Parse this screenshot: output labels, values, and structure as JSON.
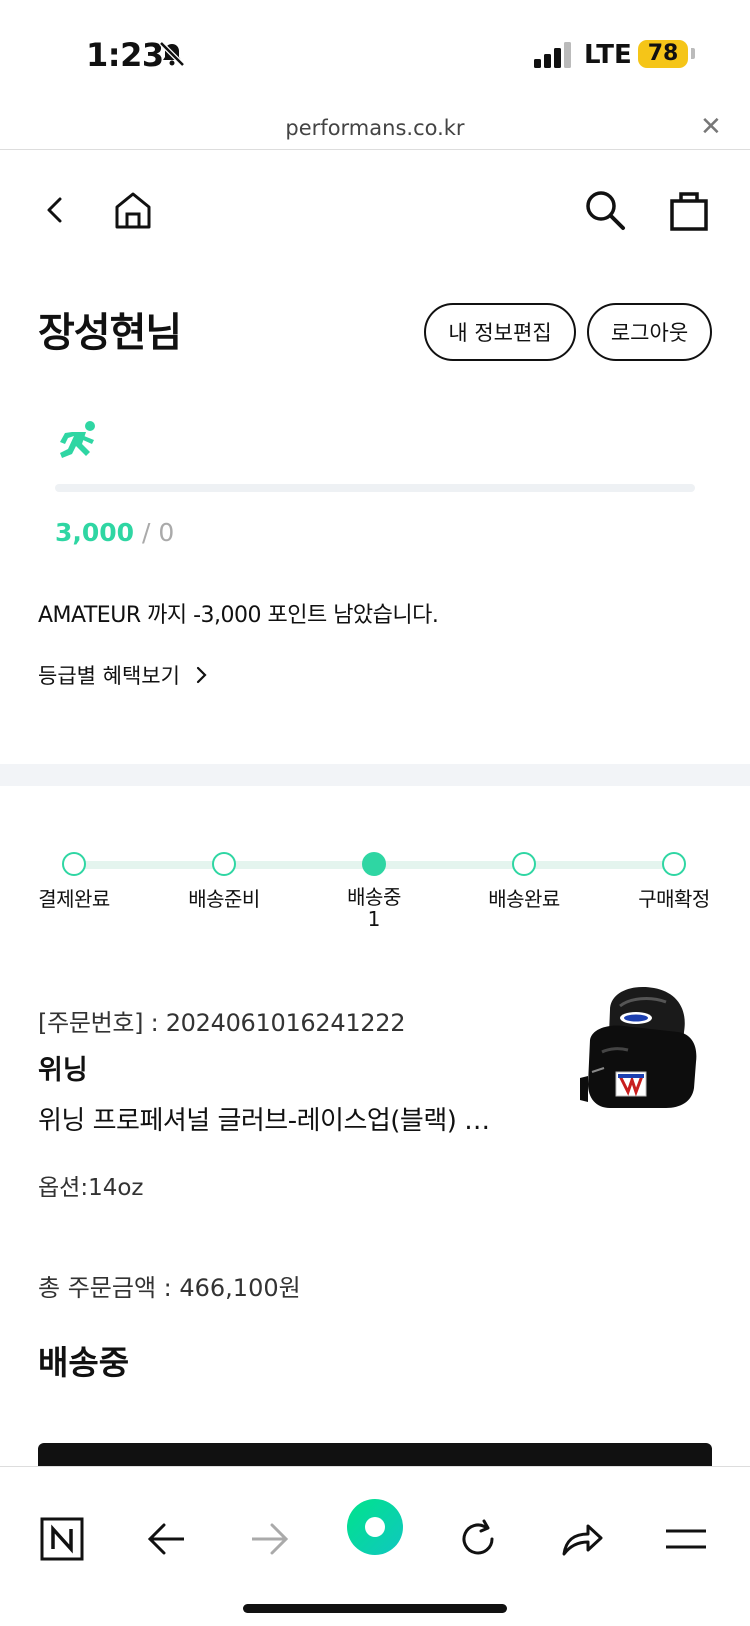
{
  "status_bar": {
    "time": "1:23",
    "network": "LTE",
    "battery": "78",
    "icons": [
      "bell-muted-icon",
      "signal-icon"
    ]
  },
  "browser": {
    "url": "performans.co.kr",
    "close_icon": "close-icon"
  },
  "header": {
    "icons": [
      "back-icon",
      "home-icon",
      "search-icon",
      "shopping-bag-icon"
    ]
  },
  "user": {
    "name": "장성현님",
    "edit_profile_label": "내 정보편집",
    "logout_label": "로그아웃",
    "points_current": "3,000",
    "points_sep": "/",
    "points_max": "0",
    "progress_fraction": 1.0,
    "grade_message": "AMATEUR 까지 -3,000 포인트 남았습니다.",
    "benefits_link": "등급별 혜택보기",
    "accent_color": "#2fd6a3"
  },
  "order_steps": [
    {
      "label": "결제완료",
      "count": "",
      "active": false
    },
    {
      "label": "배송준비",
      "count": "",
      "active": false
    },
    {
      "label": "배송중",
      "count": "1",
      "active": true
    },
    {
      "label": "배송완료",
      "count": "",
      "active": false
    },
    {
      "label": "구매확정",
      "count": "",
      "active": false
    }
  ],
  "order": {
    "number": "[주문번호] : 2024061016241222",
    "brand": "위닝",
    "product_name": "위닝 프로페셔널 글러브-레이스업(블랙) …",
    "option": "옵션:14oz",
    "total": "총 주문금액 : 466,100원",
    "status": "배송중"
  },
  "toolbar": {
    "icons": [
      "naver-n-icon",
      "arrow-left-icon",
      "arrow-right-icon",
      "green-dot-icon",
      "refresh-icon",
      "share-icon",
      "menu-icon"
    ]
  }
}
